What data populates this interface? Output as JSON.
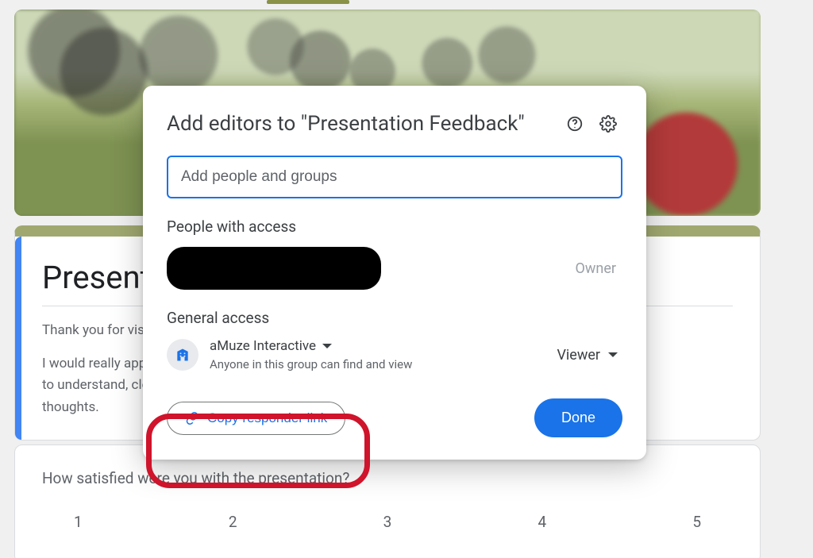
{
  "form": {
    "title": "Presentation Feedback",
    "intro_line": "Thank you for visiting",
    "desc_line1": "I would really appreciate your feedback on how to make my presentations better i.e.  easy",
    "desc_line2": "to understand, clear, engaging and memorable. Please use the form below to let me know your",
    "desc_line3": "thoughts."
  },
  "question": {
    "title": "How satisfied were you with the presentation?",
    "scale": [
      "1",
      "2",
      "3",
      "4",
      "5"
    ]
  },
  "share_modal": {
    "title": "Add editors to \"Presentation Feedback\"",
    "input_placeholder": "Add people and groups",
    "people_section": "People with access",
    "owner_role": "Owner",
    "general_section": "General access",
    "access_group": "aMuze Interactive",
    "access_sub": "Anyone in this group can find and view",
    "role": "Viewer",
    "copy_label": "Copy responder link",
    "done_label": "Done"
  }
}
